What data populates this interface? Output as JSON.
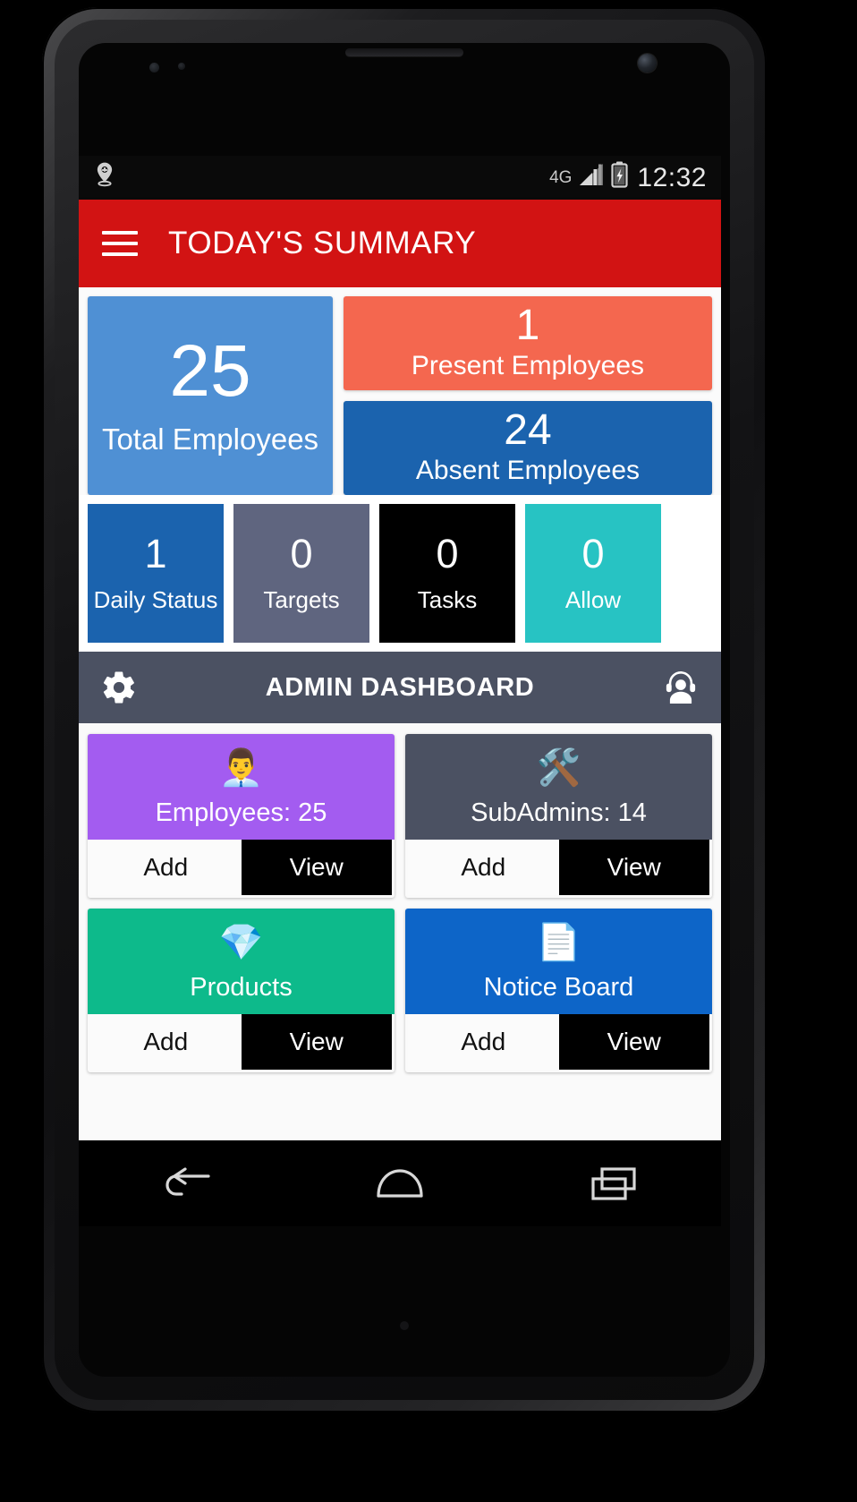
{
  "status_bar": {
    "location_icon": "location-pin-icon",
    "network_label": "4G",
    "signal_icon": "signal-bars-icon",
    "battery_icon": "battery-charging-icon",
    "time": "12:32"
  },
  "app_bar": {
    "menu_icon": "hamburger-menu-icon",
    "title": "TODAY'S SUMMARY",
    "color": "#d21313"
  },
  "summary": {
    "total": {
      "value": "25",
      "label": "Total Employees",
      "color": "#4f90d4"
    },
    "present": {
      "value": "1",
      "label": "Present Employees",
      "color": "#f4674f"
    },
    "absent": {
      "value": "24",
      "label": "Absent Employees",
      "color": "#1b63ae"
    }
  },
  "mini_tiles": [
    {
      "value": "1",
      "label": "Daily Status",
      "color": "#1b63ae"
    },
    {
      "value": "0",
      "label": "Targets",
      "color": "#5f657f"
    },
    {
      "value": "0",
      "label": "Tasks",
      "color": "#000000"
    },
    {
      "value": "0",
      "label": "Allow",
      "color": "#27c3c3"
    }
  ],
  "scroll_chevron_icon": "chevron-right-icon",
  "admin_bar": {
    "settings_icon": "gear-icon",
    "title": "ADMIN DASHBOARD",
    "support_icon": "headset-support-icon",
    "color": "#4b5162"
  },
  "cards": [
    {
      "label": "Employees: 25",
      "icon": "businessman-icon",
      "emoji": "👨‍💼",
      "color": "#a35cf0",
      "add_label": "Add",
      "view_label": "View"
    },
    {
      "label": "SubAdmins: 14",
      "icon": "gear-wrench-icon",
      "emoji": "🛠️",
      "color": "#4b5162",
      "add_label": "Add",
      "view_label": "View"
    },
    {
      "label": "Products",
      "icon": "product-gift-hand-icon",
      "emoji": "💎",
      "color": "#0dba8b",
      "add_label": "Add",
      "view_label": "View"
    },
    {
      "label": "Notice Board",
      "icon": "notice-board-icon",
      "emoji": "📄",
      "color": "#0d65c8",
      "add_label": "Add",
      "view_label": "View"
    }
  ],
  "nav_bar": {
    "back_icon": "back-arrow-icon",
    "home_icon": "home-icon",
    "recents_icon": "recent-apps-icon"
  }
}
